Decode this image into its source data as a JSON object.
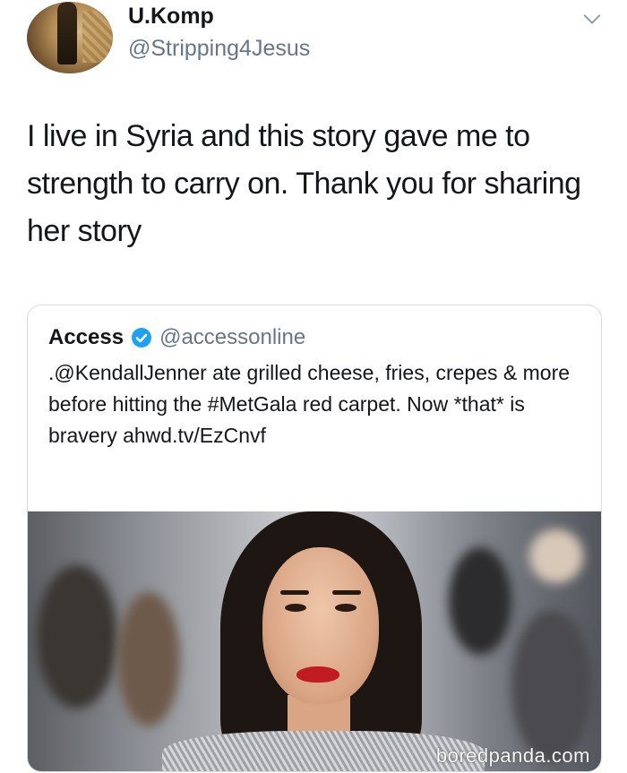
{
  "tweet": {
    "display_name": "U.Komp",
    "handle": "@Stripping4Jesus",
    "text": "I live in Syria and this story gave me to strength to carry on. Thank you for sharing her story"
  },
  "quoted_tweet": {
    "display_name": "Access",
    "handle": "@accessonline",
    "text": ".@KendallJenner ate grilled cheese, fries, crepes & more before hitting the #MetGala red carpet. Now *that* is bravery ahwd.tv/EzCnvf",
    "verified": true
  },
  "watermark": "boredpanda.com",
  "icons": {
    "menu": "chevron-down-icon",
    "verified": "verified-badge-icon"
  },
  "colors": {
    "text_primary": "#14171a",
    "text_secondary": "#657786",
    "verified_blue": "#1da1f2",
    "border": "#d5dde3",
    "lipstick": "#c11b24"
  }
}
